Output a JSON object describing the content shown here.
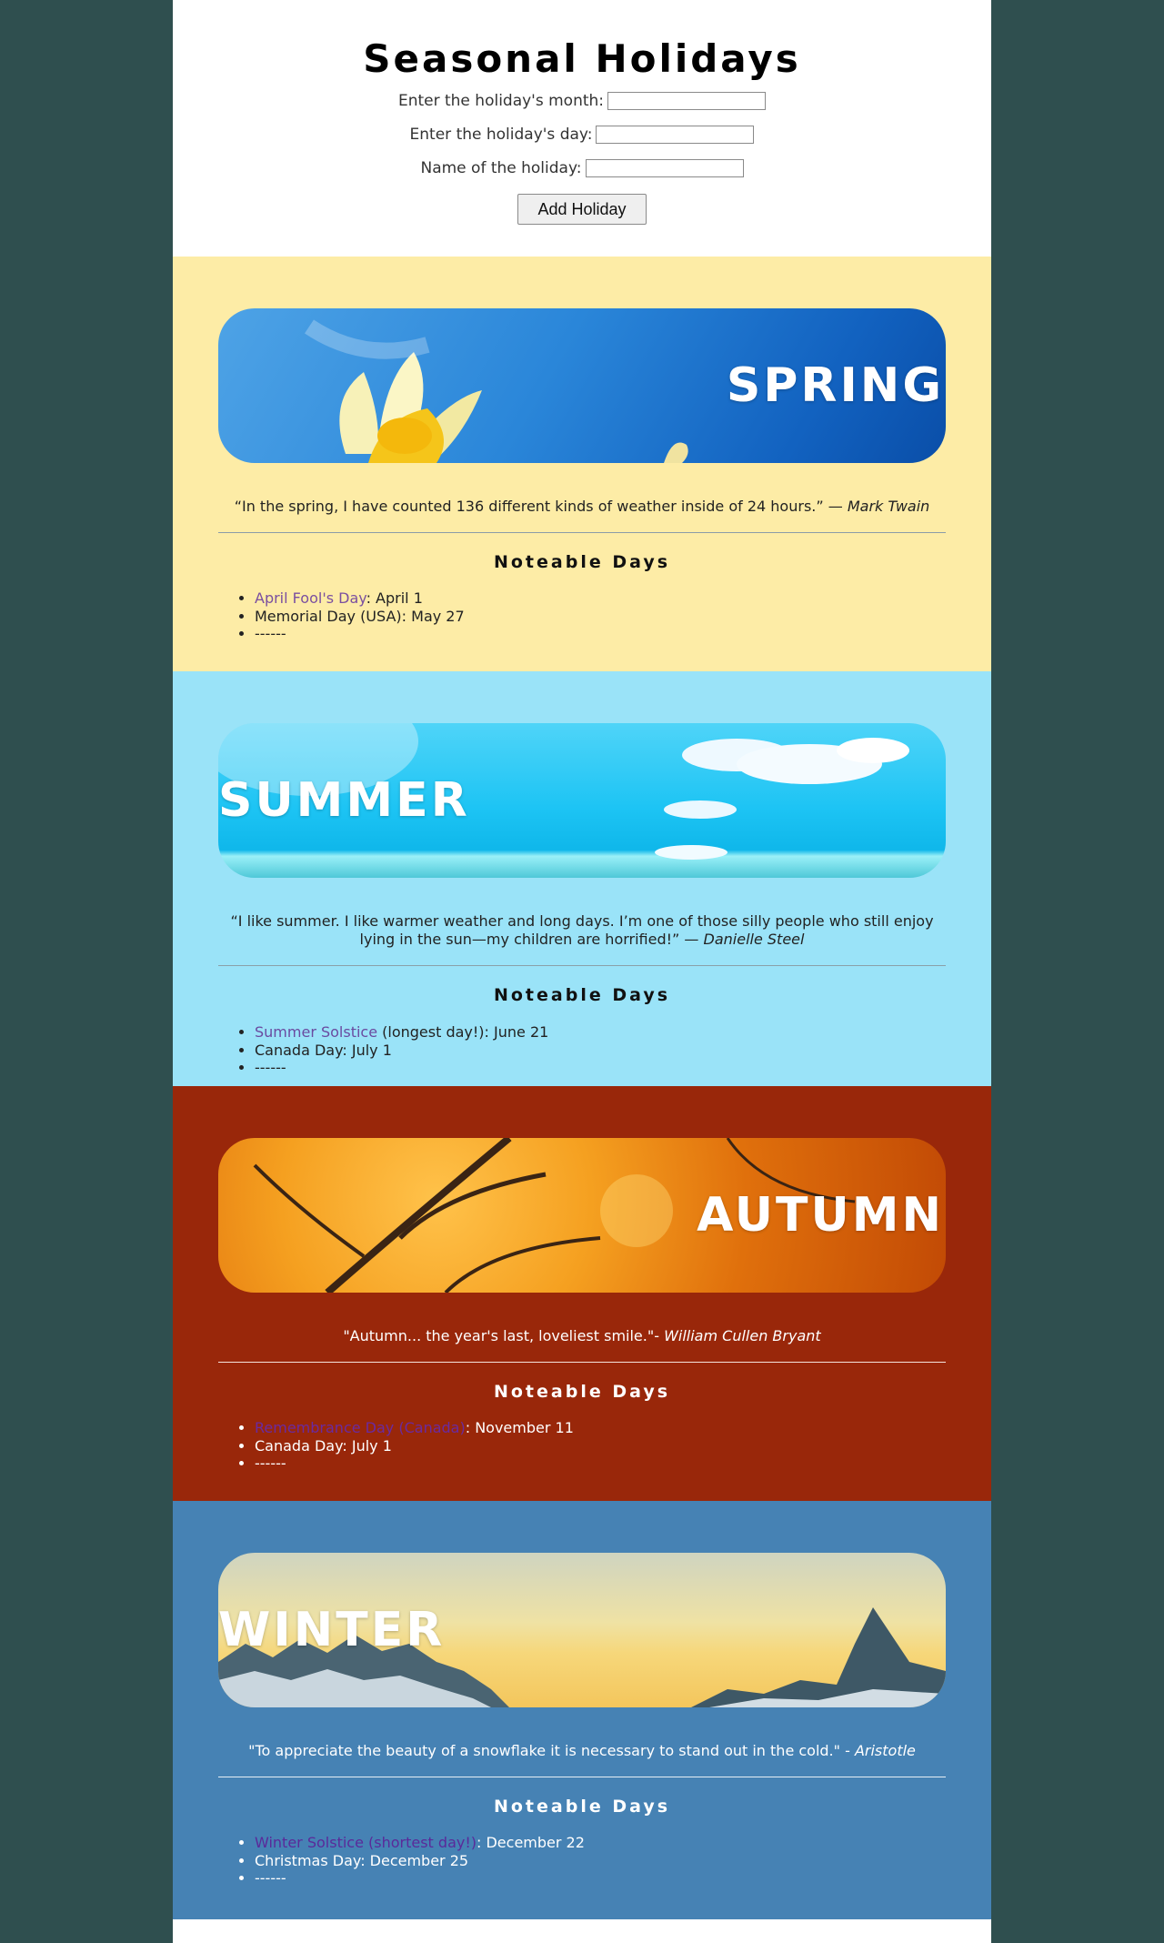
{
  "header": {
    "title": "Seasonal Holidays",
    "month_label": "Enter the holiday's month:",
    "day_label": "Enter the holiday's day:",
    "name_label": "Name of the holiday:",
    "month_value": "",
    "day_value": "",
    "name_value": "",
    "add_button": "Add Holiday"
  },
  "seasons": {
    "spring": {
      "banner_title": "SPRING",
      "quote": "“In the spring, I have counted 136 different kinds of weather inside of 24 hours.” — ",
      "author": "Mark Twain",
      "days_title": "Noteable Days",
      "items": [
        {
          "link": "April Fool's Day",
          "text": ": April 1"
        },
        {
          "link": "",
          "text": "Memorial Day (USA): May 27"
        },
        {
          "link": "",
          "text": "------"
        }
      ]
    },
    "summer": {
      "banner_title": "SUMMER",
      "quote": "“I like summer. I like warmer weather and long days. I’m one of those silly people who still enjoy lying in the sun—my children are horrified!” — ",
      "author": "Danielle Steel",
      "days_title": "Noteable Days",
      "items": [
        {
          "link": "Summer Solstice",
          "text": " (longest day!): June 21"
        },
        {
          "link": "",
          "text": "Canada Day: July 1"
        },
        {
          "link": "",
          "text": "------"
        }
      ]
    },
    "autumn": {
      "banner_title": "AUTUMN",
      "quote": "\"Autumn... the year's last, loveliest smile.\"- ",
      "author": "William Cullen Bryant",
      "days_title": "Noteable Days",
      "items": [
        {
          "link": "Remembrance Day (Canada)",
          "text": ": November 11"
        },
        {
          "link": "",
          "text": "Canada Day: July 1"
        },
        {
          "link": "",
          "text": "------"
        }
      ]
    },
    "winter": {
      "banner_title": "WINTER",
      "quote": "\"To appreciate the beauty of a snowflake it is necessary to stand out in the cold.\" - ",
      "author": "Aristotle",
      "days_title": "Noteable Days",
      "items": [
        {
          "link": "Winter Solstice (shortest day!)",
          "text": ": December 22"
        },
        {
          "link": "",
          "text": "Christmas Day: December 25"
        },
        {
          "link": "",
          "text": "------"
        }
      ]
    }
  },
  "colors": {
    "page_bg": "#2f4f4f",
    "spring_bg": "#fdeca6",
    "summer_bg": "#9ae3f8",
    "autumn_bg": "#99270a",
    "winter_bg": "#4682b4"
  }
}
